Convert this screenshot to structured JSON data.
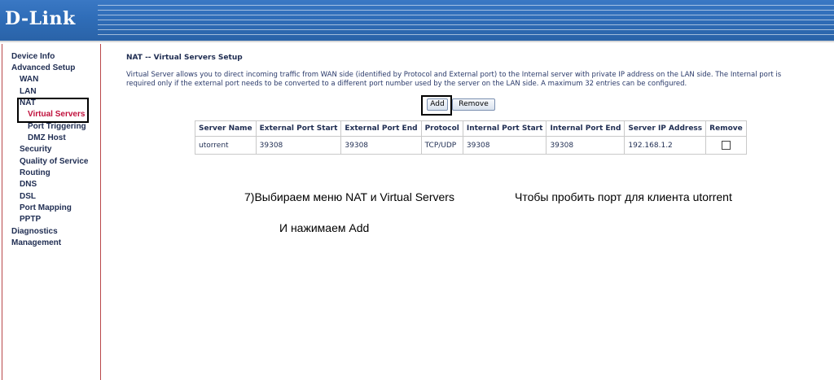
{
  "header": {
    "logo": "D-Link"
  },
  "sidebar": {
    "items": [
      {
        "label": "Device Info"
      },
      {
        "label": "Advanced Setup"
      },
      {
        "label": "WAN"
      },
      {
        "label": "LAN"
      },
      {
        "label": "NAT"
      },
      {
        "label": "Virtual Servers",
        "active": true
      },
      {
        "label": "Port Triggering"
      },
      {
        "label": "DMZ Host"
      },
      {
        "label": "Security"
      },
      {
        "label": "Quality of Service"
      },
      {
        "label": "Routing"
      },
      {
        "label": "DNS"
      },
      {
        "label": "DSL"
      },
      {
        "label": "Port Mapping"
      },
      {
        "label": "PPTP"
      },
      {
        "label": "Diagnostics"
      },
      {
        "label": "Management"
      }
    ],
    "active_color": "#c0103c",
    "text_color": "#1f2d52"
  },
  "main": {
    "title": "NAT -- Virtual Servers Setup",
    "description": "Virtual Server allows you to direct incoming traffic from WAN side (identified by Protocol and External port) to the Internal server with private IP address on the LAN side. The Internal port is required only if the external port needs to be converted to a different port number used by the server on the LAN side. A maximum 32 entries can be configured.",
    "buttons": {
      "add": "Add",
      "remove": "Remove"
    },
    "table": {
      "headers": [
        "Server Name",
        "External Port Start",
        "External Port End",
        "Protocol",
        "Internal Port Start",
        "Internal Port End",
        "Server IP Address",
        "Remove"
      ],
      "rows": [
        [
          "utorrent",
          "39308",
          "39308",
          "TCP/UDP",
          "39308",
          "39308",
          "192.168.1.2",
          ""
        ]
      ]
    }
  },
  "annotations": {
    "step": "7)Выбираем меню NAT  и   Virtual Servers",
    "purpose": "Чтобы пробить порт для клиента utorrent",
    "action": "И нажимаем Add"
  },
  "colors": {
    "header_blue": "#2f6db8",
    "sidebar_border": "#b9484a"
  }
}
